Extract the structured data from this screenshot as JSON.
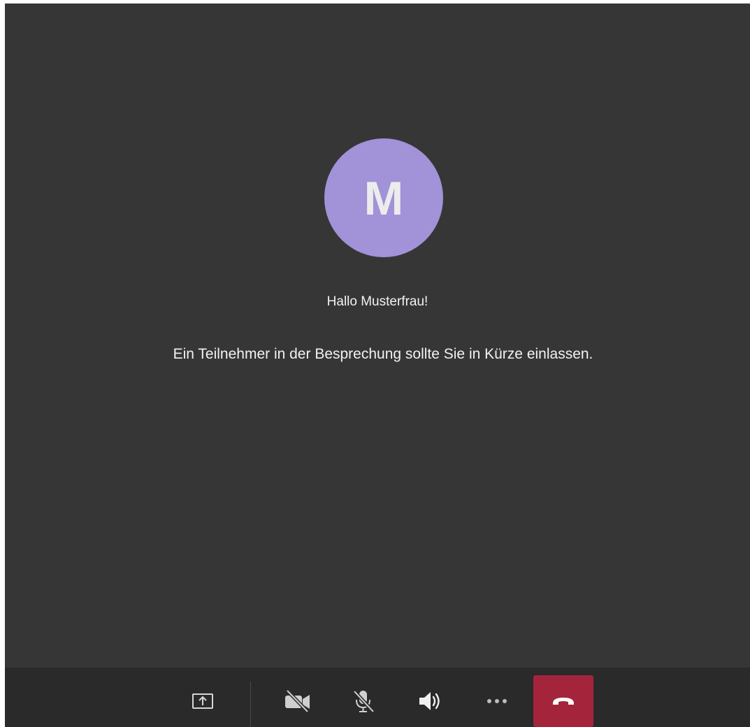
{
  "participant": {
    "initial": "M",
    "avatar_color": "#a292d8"
  },
  "messages": {
    "greeting": "Hallo Musterfrau!",
    "waiting": "Ein Teilnehmer in der Besprechung sollte Sie in Kürze einlassen."
  },
  "toolbar": {
    "buttons": [
      {
        "name": "share-screen",
        "icon": "share-screen-icon"
      },
      {
        "name": "camera-off",
        "icon": "camera-off-icon"
      },
      {
        "name": "mic-muted",
        "icon": "mic-off-icon"
      },
      {
        "name": "speaker",
        "icon": "speaker-icon"
      },
      {
        "name": "more-options",
        "icon": "more-icon"
      },
      {
        "name": "hang-up",
        "icon": "phone-hangup-icon"
      }
    ],
    "hangup_color": "#a4243b"
  },
  "colors": {
    "background": "#363636",
    "toolbar": "#2a2a2a",
    "text": "#f2f2f2"
  }
}
